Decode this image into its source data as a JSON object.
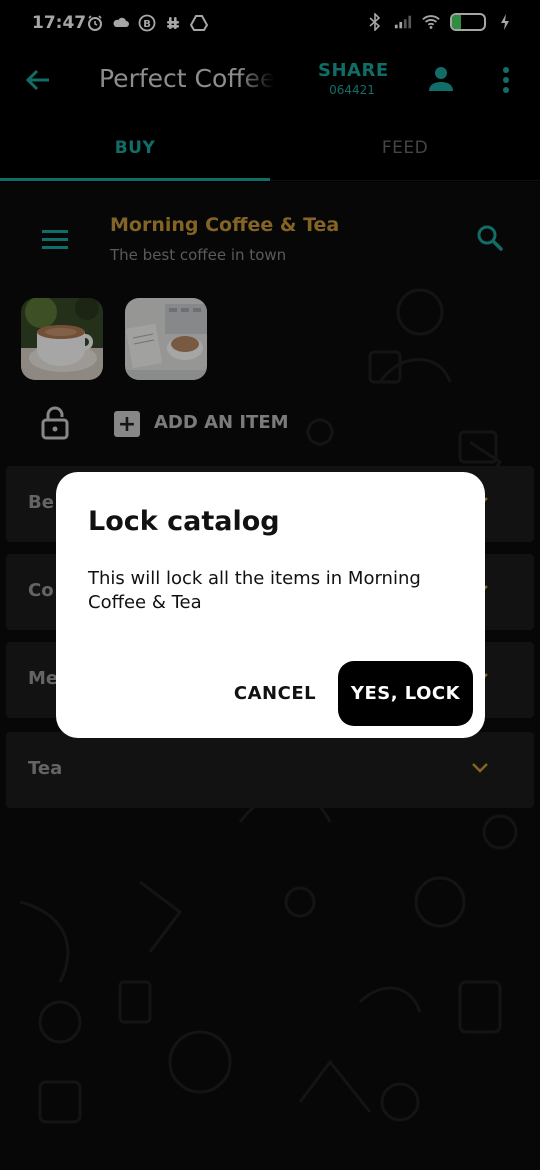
{
  "status_bar": {
    "time": "17:47",
    "battery": "29",
    "battery_level": 0.29
  },
  "app_bar": {
    "title": "Perfect Coffee",
    "share_label": "SHARE",
    "share_code": "064421"
  },
  "tabs": [
    {
      "label": "BUY",
      "active": true
    },
    {
      "label": "FEED",
      "active": false
    }
  ],
  "catalog": {
    "name": "Morning Coffee & Tea",
    "tagline": "The best coffee in town",
    "add_item_label": "ADD AN ITEM"
  },
  "categories": [
    {
      "label": "Be"
    },
    {
      "label": "Co"
    },
    {
      "label": "Me"
    },
    {
      "label": "Tea"
    }
  ],
  "dialog": {
    "title": "Lock catalog",
    "body": "This will lock all the items in Morning Coffee & Tea",
    "cancel_label": "CANCEL",
    "confirm_label": "YES, LOCK"
  },
  "colors": {
    "accent": "#1aa89e",
    "catalog_name": "#c99a3a",
    "chevron": "#c99a3a"
  }
}
